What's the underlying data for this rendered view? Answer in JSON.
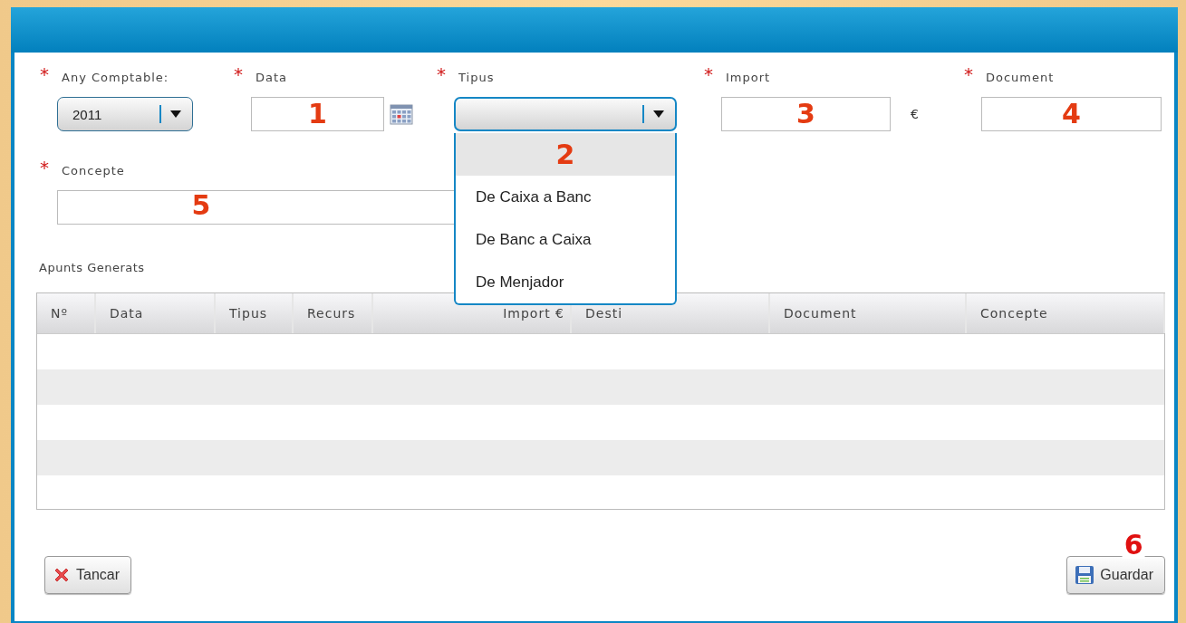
{
  "fields": [
    {
      "kind": "select",
      "label": "Any Comptable:",
      "required": "*",
      "value": "2011",
      "expanded": false
    },
    {
      "kind": "date",
      "label": "Data",
      "required": "*",
      "marker": "1"
    },
    {
      "kind": "select",
      "label": "Tipus",
      "required": "*",
      "expanded": true,
      "options": [
        {
          "marker": "2",
          "selected": true
        },
        {
          "label": "De Caixa a Banc",
          "selected": false
        },
        {
          "label": "De Banc a Caixa",
          "selected": false
        },
        {
          "label": "De Menjador",
          "selected": false
        }
      ]
    },
    {
      "kind": "currency",
      "label": "Import",
      "required": "*",
      "marker": "3",
      "unit": "€"
    },
    {
      "kind": "text",
      "label": "Document",
      "required": "*",
      "marker": "4"
    }
  ],
  "concepte": {
    "label": "Concepte",
    "required": "*",
    "marker": "5"
  },
  "table": {
    "title": "Apunts Generats",
    "columns": [
      {
        "label": "Nº"
      },
      {
        "label": "Data"
      },
      {
        "label": "Tipus"
      },
      {
        "label": "Recurs"
      },
      {
        "label": "Import €"
      },
      {
        "label": "Desti"
      },
      {
        "label": "Document"
      },
      {
        "label": "Concepte"
      }
    ]
  },
  "buttons": [
    {
      "kind": "close",
      "label": "Tancar"
    },
    {
      "kind": "save",
      "label": "Guardar",
      "marker": "6"
    }
  ]
}
